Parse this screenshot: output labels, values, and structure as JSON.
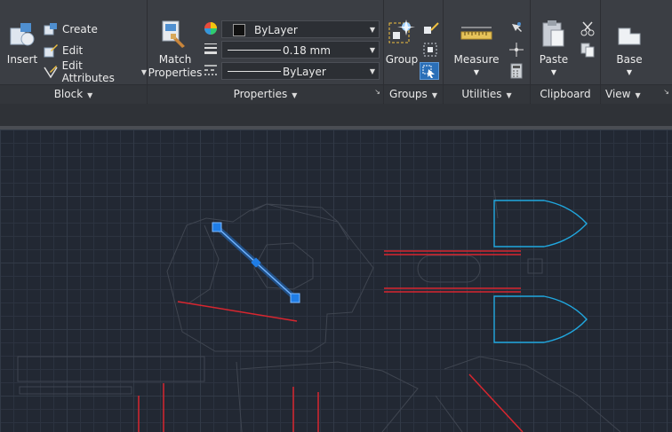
{
  "ribbon": {
    "block": {
      "title": "Block",
      "insert_label": "Insert",
      "create_label": "Create",
      "edit_label": "Edit",
      "edit_attributes_label": "Edit Attributes"
    },
    "properties": {
      "title": "Properties",
      "match_label_line1": "Match",
      "match_label_line2": "Properties",
      "color_value": "ByLayer",
      "lineweight_value": "0.18 mm",
      "linetype_value": "ByLayer"
    },
    "groups": {
      "title": "Groups",
      "group_label": "Group"
    },
    "utilities": {
      "title": "Utilities",
      "measure_label": "Measure"
    },
    "clipboard": {
      "title": "Clipboard",
      "paste_label": "Paste"
    },
    "view": {
      "title": "View",
      "base_label": "Base"
    }
  },
  "colors": {
    "ribbon_bg": "#3b3e44",
    "canvas_bg": "#222833",
    "selection_blue": "#1f7de6",
    "cyan_geometry": "#20a8e0",
    "red_geometry": "#d8262f",
    "faint_geometry": "#3f4550"
  }
}
